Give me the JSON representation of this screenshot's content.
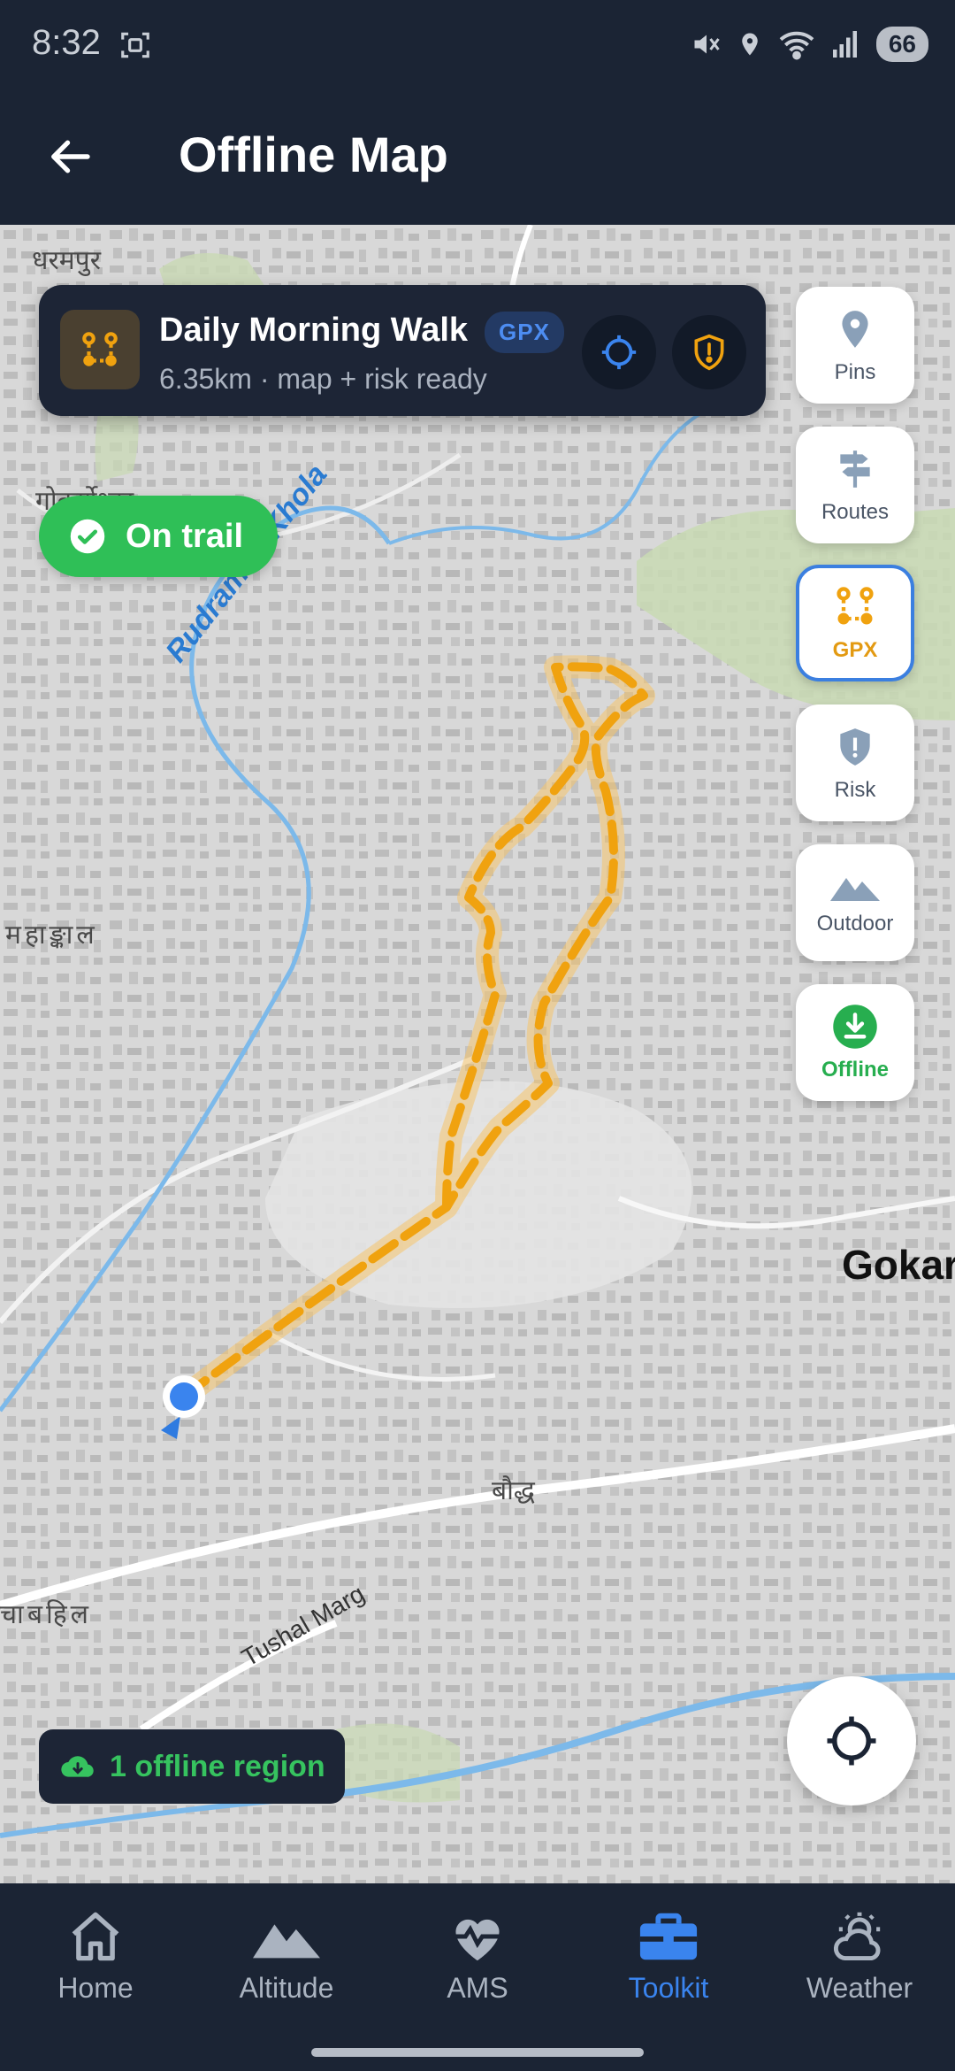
{
  "status_bar": {
    "time": "8:32",
    "battery": "66"
  },
  "header": {
    "title": "Offline Map"
  },
  "track": {
    "title": "Daily Morning Walk",
    "badge": "GPX",
    "subtitle": "6.35km · map + risk ready"
  },
  "trail_status": {
    "label": "On trail"
  },
  "tools": [
    {
      "label": "Pins",
      "icon": "pin-icon"
    },
    {
      "label": "Routes",
      "icon": "signpost-icon"
    },
    {
      "label": "GPX",
      "icon": "gpx-route-icon",
      "active": true
    },
    {
      "label": "Risk",
      "icon": "shield-alert-icon"
    },
    {
      "label": "Outdoor",
      "icon": "mountain-icon"
    },
    {
      "label": "Offline",
      "icon": "download-icon"
    }
  ],
  "map_labels": {
    "dharampur": "धरमपुर",
    "gokarneshwor_left": "गोकर्णेश्वर",
    "river": "Rudramati Khola",
    "mahankal": "महाङ्काल",
    "gokarna": "Gokarna",
    "boudha": "बौद्ध",
    "chabahil": "चाबहिल",
    "tushal_marg": "Tushal Marg"
  },
  "offline_region": {
    "label": "1 offline region"
  },
  "nav": [
    {
      "label": "Home",
      "icon": "home-icon"
    },
    {
      "label": "Altitude",
      "icon": "mountains-icon"
    },
    {
      "label": "AMS",
      "icon": "heartbeat-icon"
    },
    {
      "label": "Toolkit",
      "icon": "toolbox-icon",
      "active": true
    },
    {
      "label": "Weather",
      "icon": "weather-icon"
    }
  ],
  "colors": {
    "accent": "#3a84ee",
    "route": "#f0a20f",
    "success": "#2fbf57",
    "dark": "#1b2434"
  }
}
